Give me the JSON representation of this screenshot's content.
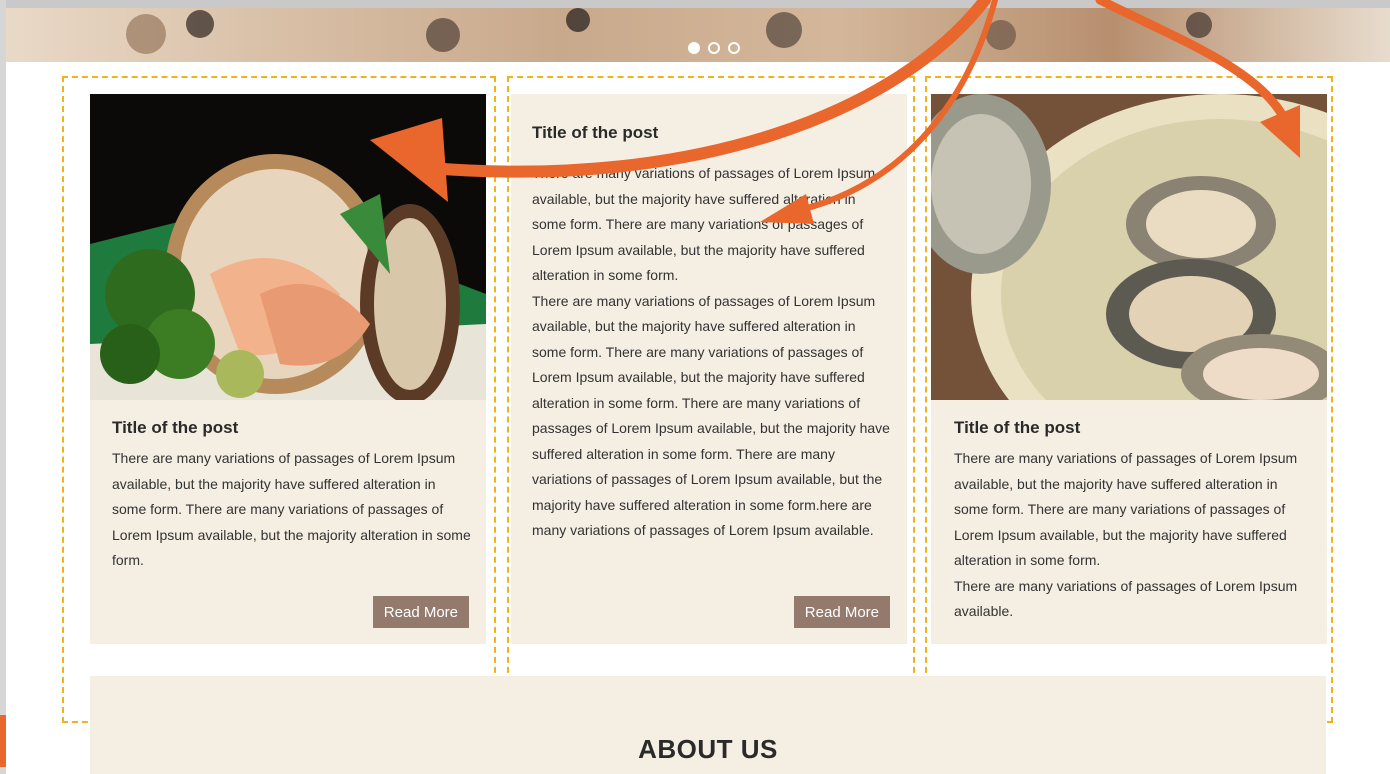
{
  "slider": {
    "dots": [
      true,
      false,
      false
    ]
  },
  "posts": [
    {
      "title": "Title of the post",
      "text": "There are many variations of passages of Lorem Ipsum available, but the majority have suffered alteration in some form. There are many variations of passages of Lorem Ipsum available, but the majority alteration in some form.",
      "button": "Read More",
      "image": "clam-sashimi-dish"
    },
    {
      "title": "Title of the post",
      "text": "There are many variations of passages of Lorem Ipsum available, but the majority have suffered alteration in some form. There are many variations of passages of Lorem Ipsum available, but the majority have suffered alteration in some form.\nThere are many variations of passages of Lorem Ipsum available, but the majority have suffered alteration in some form. There are many variations of passages of Lorem Ipsum available, but the majority have suffered alteration in some form. There are many variations of passages of Lorem Ipsum available, but the majority have suffered alteration in some form. There are many variations of passages of Lorem Ipsum available, but the majority have suffered alteration in some form.here are many variations of passages of Lorem Ipsum available.",
      "button": "Read More"
    },
    {
      "title": "Title of the post",
      "text": "There are many variations of passages of Lorem Ipsum available, but the majority have suffered alteration in some form. There are many variations of passages of Lorem Ipsum available, but the majority have suffered alteration in some form.\nThere are many variations of passages of Lorem Ipsum available.",
      "image": "oysters-plate"
    }
  ],
  "about": {
    "heading": "ABOUT US"
  },
  "colors": {
    "card_bg": "#f4eee3",
    "button_bg": "#937a6d",
    "dashed_outline": "#f2b21d",
    "arrow": "#e9662c"
  }
}
